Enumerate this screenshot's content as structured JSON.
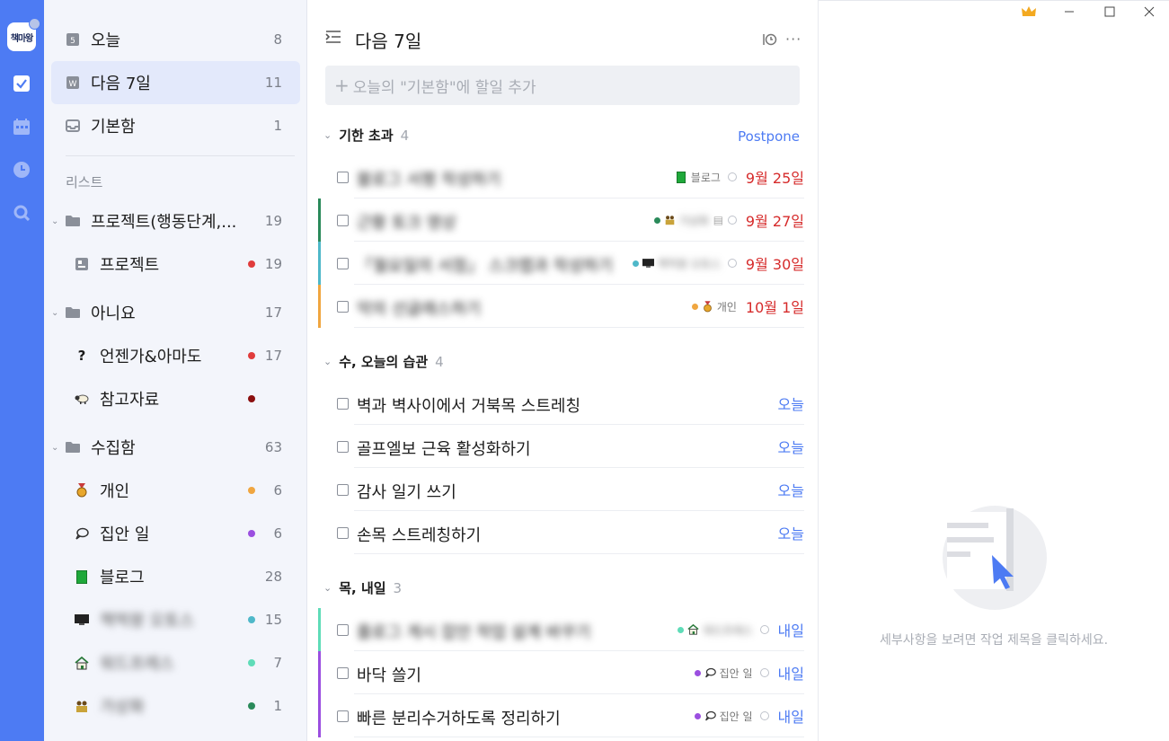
{
  "rail": {
    "avatar_text": "책마왕"
  },
  "sidebar": {
    "smart": [
      {
        "label": "오늘",
        "count": "8",
        "icon_text": "5"
      },
      {
        "label": "다음 7일",
        "count": "11",
        "icon_text": "W"
      },
      {
        "label": "기본함",
        "count": "1"
      }
    ],
    "section_label": "리스트",
    "lists": [
      {
        "label": "프로젝트(행동단계,...",
        "count": "19"
      },
      {
        "label": "프로젝트",
        "count": "19",
        "dot": "#e03c3c"
      },
      {
        "label": "아니요",
        "count": "17"
      },
      {
        "label": "언젠가&아마도",
        "count": "17",
        "dot": "#e03c3c"
      },
      {
        "label": "참고자료",
        "count": "",
        "dot": "#8b0f0f"
      },
      {
        "label": "수집함",
        "count": "63"
      },
      {
        "label": "개인",
        "count": "6",
        "dot": "#f0a640"
      },
      {
        "label": "집안 일",
        "count": "6",
        "dot": "#9b4fe0"
      },
      {
        "label": "블로그",
        "count": "28"
      },
      {
        "label": "책먹왕 오토스",
        "count": "15",
        "dot": "#4fb8c9"
      },
      {
        "label": "워드프레스",
        "count": "7",
        "dot": "#5fdcb8"
      },
      {
        "label": "가상화",
        "count": "1",
        "dot": "#2a8a5a"
      }
    ]
  },
  "main": {
    "title": "다음 7일",
    "add_placeholder": "오늘의 \"기본함\"에 할일 추가",
    "postpone": "Postpone",
    "groups": [
      {
        "title": "기한 초과",
        "count": "4"
      },
      {
        "title": "수, 오늘의 습관",
        "count": "4"
      },
      {
        "title": "목, 내일",
        "count": "3"
      }
    ],
    "tasks": [
      {
        "title": "블로그 서평 작성하기",
        "tag": "블로그",
        "due": "9월 25일"
      },
      {
        "title": "근황 토크 영상",
        "tag": "가상화",
        "due": "9월 27일"
      },
      {
        "title": "「월요일의 서점」 스크랩과 작성하기",
        "tag": "책먹왕 오토스",
        "due": "9월 30일"
      },
      {
        "title": "악의 선글래스하기",
        "tag": "개인",
        "due": "10월 1일"
      },
      {
        "title": "벽과 벽사이에서 거북목 스트레칭",
        "due": "오늘"
      },
      {
        "title": "골프엘보 근육 활성화하기",
        "due": "오늘"
      },
      {
        "title": "감사 일기 쓰기",
        "due": "오늘"
      },
      {
        "title": "손목 스트레칭하기",
        "due": "오늘"
      },
      {
        "title": "플로그 게시 잡안 작업 설계 바꾸기",
        "tag": "워드프레스",
        "due": "내일"
      },
      {
        "title": "바닥 쓸기",
        "tag": "집안 일",
        "due": "내일"
      },
      {
        "title": "빠른 분리수거하도록 정리하기",
        "tag": "집안 일",
        "due": "내일"
      }
    ]
  },
  "detail": {
    "empty_text": "세부사항을 보려면 작업 제목을 클릭하세요."
  },
  "colors": {
    "accent": "#4d7bf3",
    "overdue": "#d62b2b",
    "rail": "#4d7bf3"
  }
}
